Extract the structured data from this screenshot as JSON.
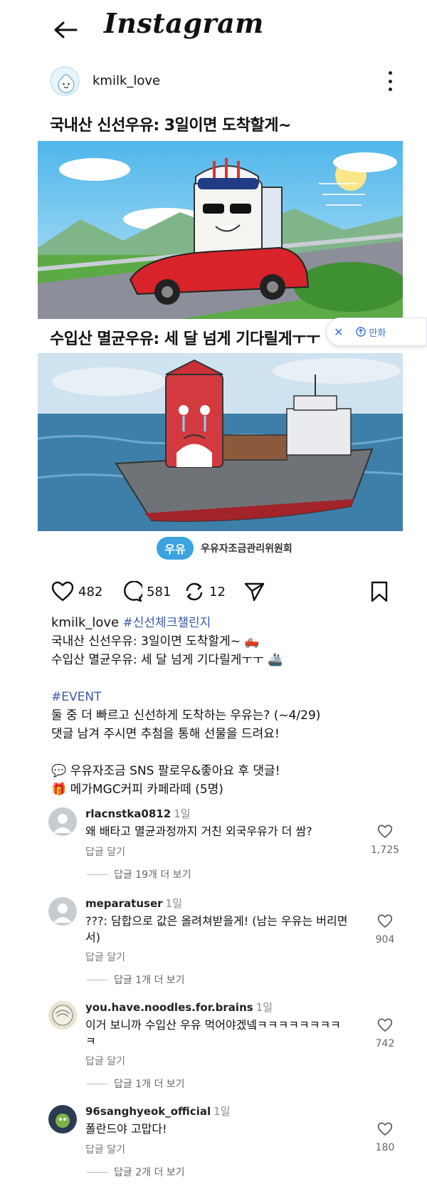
{
  "header": {
    "app_title": "Instagram"
  },
  "post": {
    "username": "kmilk_love",
    "panel1_caption": "국내산 신선우유: 3일이면 도착할게~",
    "panel2_caption": "수입산 멸균우유: 세 달 넘게 기다릴게ㅜㅜ",
    "brand_logo_text": "우유",
    "brand_name": "우유자조금관리위원회"
  },
  "ad_popup": {
    "label": "만화"
  },
  "actions": {
    "likes": "482",
    "comments": "581",
    "reposts": "12"
  },
  "caption": {
    "username": "kmilk_love",
    "hashtag": "#신선체크챌린지",
    "line1": "국내산 신선우유: 3일이면 도착할게~ 🛻",
    "line2": "수입산 멸균우유: 세 달 넘게 기다릴게ㅜㅜ 🚢",
    "event_tag": "#EVENT",
    "line3": "둘 중 더 빠르고 신선하게 도착하는 우유는? (~4/29)",
    "line4": "댓글 남겨 주시면 추첨을 통해 선물을 드려요!",
    "line5": "💬 우유자조금 SNS 팔로우&좋아요 후 댓글!",
    "line6": "🎁 메가MGC커피 카페라떼 (5명)"
  },
  "comments": [
    {
      "user": "rlacnstka0812",
      "time": "1일",
      "text": "왜 배타고 멸균과정까지 거친 외국우유가 더 쌈?",
      "reply": "답글 달기",
      "more": "답글 19개 더 보기",
      "likes": "1,725"
    },
    {
      "user": "meparatuser",
      "time": "1일",
      "text": "???: 담합으로 값은 올려쳐받을게! (남는 우유는 버리면서)",
      "reply": "답글 달기",
      "more": "답글 1개 더 보기",
      "likes": "904"
    },
    {
      "user": "you.have.noodles.for.brains",
      "time": "1일",
      "text": "이거 보니까 수입산 우유 먹어야겠넼ㅋㅋㅋㅋㅋㅋㅋㅋㅋ",
      "reply": "답글 달기",
      "more": "답글 1개 더 보기",
      "likes": "742"
    },
    {
      "user": "96sanghyeok_official",
      "time": "1일",
      "text": "폴란드야 고맙다!",
      "reply": "답글 달기",
      "more": "답글 2개 더 보기",
      "likes": "180"
    }
  ],
  "colors": {
    "link": "#3a5aa8",
    "ad_accent": "#3a6fd8",
    "brand_blue": "#3aa3e0"
  }
}
